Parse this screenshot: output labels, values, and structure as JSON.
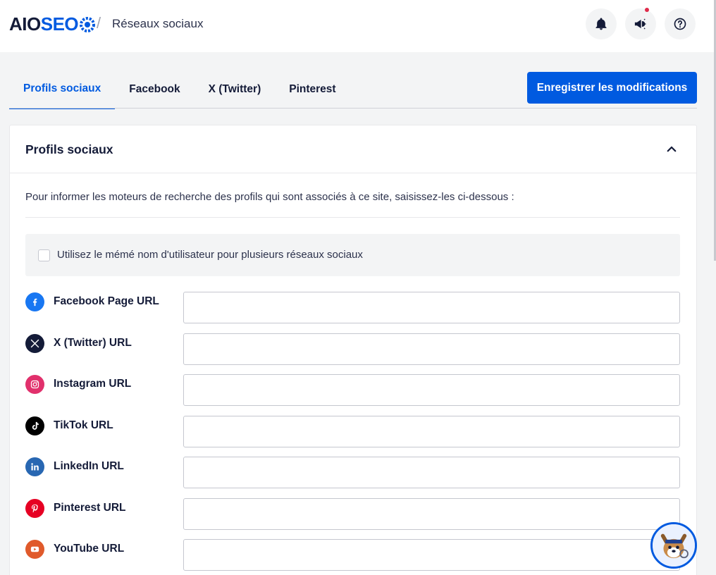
{
  "header": {
    "logo_text_a": "AIO",
    "logo_text_b": "SEO",
    "separator": "/",
    "title": "Réseaux sociaux",
    "icons": [
      "bell-icon",
      "megaphone-icon",
      "help-icon"
    ]
  },
  "tabs": [
    {
      "label": "Profils sociaux",
      "active": true
    },
    {
      "label": "Facebook",
      "active": false
    },
    {
      "label": "X (Twitter)",
      "active": false
    },
    {
      "label": "Pinterest",
      "active": false
    }
  ],
  "save_label": "Enregistrer les modifications",
  "card": {
    "title": "Profils sociaux",
    "description": "Pour informer les moteurs de recherche des profils qui sont associés à ce site, saisissez-les ci-dessous :",
    "same_username_label": "Utilisez le mémé nom d'utilisateur pour plusieurs réseaux sociaux",
    "same_username_checked": false
  },
  "profiles": [
    {
      "label": "Facebook Page URL",
      "icon": "facebook-icon",
      "value": ""
    },
    {
      "label": "X (Twitter) URL",
      "icon": "x-twitter-icon",
      "value": ""
    },
    {
      "label": "Instagram URL",
      "icon": "instagram-icon",
      "value": ""
    },
    {
      "label": "TikTok URL",
      "icon": "tiktok-icon",
      "value": ""
    },
    {
      "label": "LinkedIn URL",
      "icon": "linkedin-icon",
      "value": ""
    },
    {
      "label": "Pinterest URL",
      "icon": "pinterest-icon",
      "value": ""
    },
    {
      "label": "YouTube URL",
      "icon": "youtube-icon",
      "value": ""
    }
  ],
  "colors": {
    "accent": "#005ae0",
    "facebook": "#1877f2",
    "x": "#141b38",
    "instagram": "#e1306c",
    "tiktok": "#000000",
    "linkedin": "#2867b2",
    "pinterest": "#e60023",
    "youtube": "#e05a2b"
  }
}
